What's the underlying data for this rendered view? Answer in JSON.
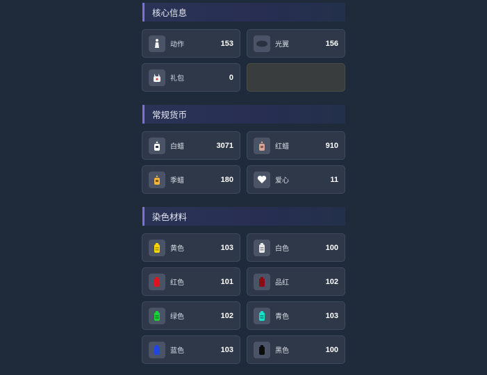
{
  "sections": [
    {
      "title": "核心信息",
      "items": [
        {
          "label": "动作",
          "value": "153",
          "icon": "figure-icon",
          "color": "#f2f2f2"
        },
        {
          "label": "光翼",
          "value": "156",
          "icon": "wing-icon",
          "color": "#2a3140"
        },
        {
          "label": "礼包",
          "value": "0",
          "icon": "gift-icon",
          "color": "#f2f2f2"
        }
      ]
    },
    {
      "title": "常规货币",
      "items": [
        {
          "label": "白蜡",
          "value": "3071",
          "icon": "white-candle-icon",
          "color": "#ffffff"
        },
        {
          "label": "红蜡",
          "value": "910",
          "icon": "red-candle-icon",
          "color": "#d6a89a"
        },
        {
          "label": "季蜡",
          "value": "180",
          "icon": "season-candle-icon",
          "color": "#f0b53a"
        },
        {
          "label": "爱心",
          "value": "11",
          "icon": "heart-icon",
          "color": "#ffffff"
        }
      ]
    },
    {
      "title": "染色材料",
      "items": [
        {
          "label": "黄色",
          "value": "103",
          "icon": "yellow-dye-icon",
          "color": "#f5d800"
        },
        {
          "label": "白色",
          "value": "100",
          "icon": "white-dye-icon",
          "color": "#e8e8e8"
        },
        {
          "label": "红色",
          "value": "101",
          "icon": "red-dye-icon",
          "color": "#e0141e"
        },
        {
          "label": "品红",
          "value": "102",
          "icon": "magenta-dye-icon",
          "color": "#8b0a14"
        },
        {
          "label": "绿色",
          "value": "102",
          "icon": "green-dye-icon",
          "color": "#18d23c"
        },
        {
          "label": "青色",
          "value": "103",
          "icon": "cyan-dye-icon",
          "color": "#19e0c8"
        },
        {
          "label": "蓝色",
          "value": "103",
          "icon": "blue-dye-icon",
          "color": "#1f47e0"
        },
        {
          "label": "黑色",
          "value": "100",
          "icon": "black-dye-icon",
          "color": "#0d0d0d"
        }
      ]
    }
  ]
}
